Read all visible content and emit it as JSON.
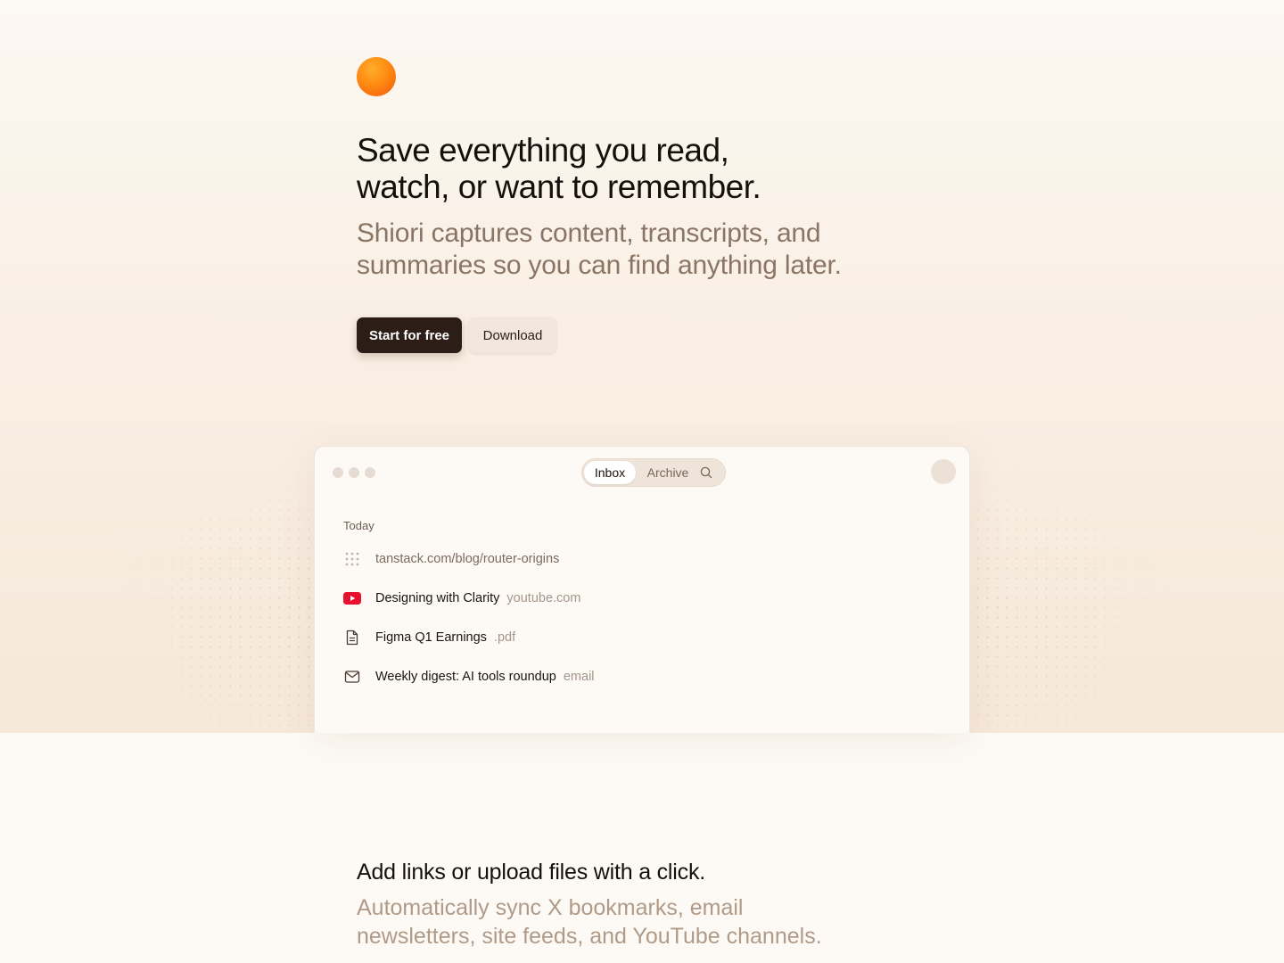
{
  "hero": {
    "headline_line1": "Save everything you read,",
    "headline_line2": "watch, or want to remember.",
    "subhead_line1": "Shiori captures content, transcripts, and",
    "subhead_line2": "summaries so you can find anything later.",
    "primary_button": "Start for free",
    "secondary_button": "Download"
  },
  "app": {
    "tabs": {
      "inbox": "Inbox",
      "archive": "Archive"
    },
    "section_label": "Today",
    "items": [
      {
        "icon": "loading-dots-icon",
        "title": "tanstack.com/blog/router-origins",
        "source": ""
      },
      {
        "icon": "youtube-icon",
        "title": "Designing with Clarity",
        "source": "youtube.com"
      },
      {
        "icon": "document-icon",
        "title": "Figma Q1 Earnings",
        "source": ".pdf"
      },
      {
        "icon": "mail-icon",
        "title": "Weekly digest: AI tools roundup",
        "source": "email"
      }
    ]
  },
  "feature": {
    "title": "Add links or upload files with a click.",
    "desc_line1": "Automatically sync X bookmarks, email",
    "desc_line2": "newsletters, site feeds, and YouTube channels."
  },
  "colors": {
    "accent_orange": "#ff8a12",
    "primary_button": "#2c1e17",
    "youtube_red": "#e8112d"
  }
}
